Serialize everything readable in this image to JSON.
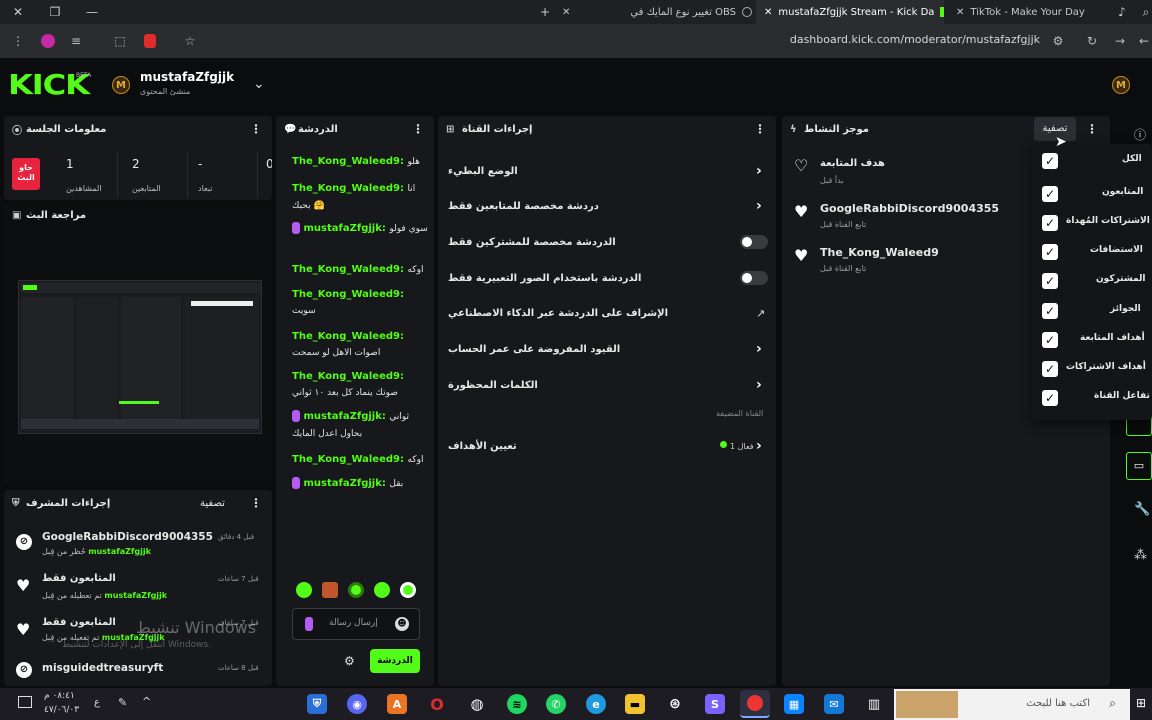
{
  "browser": {
    "tabs": [
      {
        "title": "تغيير نوع المايك في OBS"
      },
      {
        "title": "mustafaZfgjjk Stream - Kick Da"
      },
      {
        "title": "TikTok - Make Your Day"
      }
    ],
    "url": "dashboard.kick.com/moderator/mustafazfgjjk"
  },
  "header": {
    "logo": "KICK",
    "beta": "BETA",
    "user_initial": "M",
    "username": "mustafaZfgjjk",
    "role": "منشئ المحتوى"
  },
  "session": {
    "title": "معلومات الجلسة",
    "live_badge": "حاو البث",
    "stats": [
      {
        "value": "1",
        "label": "المشاهدين"
      },
      {
        "value": "2",
        "label": "المتابعين"
      },
      {
        "value": "-",
        "label": "تبعاد"
      },
      {
        "value": "0",
        "label": ""
      }
    ]
  },
  "stream_review": {
    "title": "مراجعة البث"
  },
  "mod_actions": {
    "title": "إجراءات المشرف",
    "filter": "تصفية",
    "items": [
      {
        "user": "GoogleRabbiDiscord9004355",
        "desc": "حُظر من قِبل",
        "by": "mustafaZfgjjk",
        "time": "قبل 4 دقائق",
        "icon": "ban-icon"
      },
      {
        "user": "المتابعون فقط",
        "desc": "تم تعطيله من قِبل",
        "by": "mustafaZfgjjk",
        "time": "قبل 7 ساعات",
        "icon": "heart-icon"
      },
      {
        "user": "المتابعون فقط",
        "desc": "تم تفعيله من قِبل",
        "by": "mustafaZfgjjk",
        "time": "قبل 7 ساعات",
        "icon": "heart-icon"
      },
      {
        "user": "misguidedtreasuryft",
        "desc": "",
        "by": "",
        "time": "قبل 8 ساعات",
        "icon": "ban-icon"
      }
    ]
  },
  "watermark": {
    "line1": "تنشيط Windows",
    "line2": "انتقل إلى الإعدادات لتنشيط Windows."
  },
  "chat": {
    "title": "الدردشة",
    "messages": [
      {
        "user": "The_Kong_Waleed9:",
        "text": "هلو",
        "inline": true
      },
      {
        "user": "The_Kong_Waleed9:",
        "text": "انا بحبك 🤗",
        "inline": false
      },
      {
        "user": "mustafaZfgjjk:",
        "text": "سوي فولو",
        "inline": false,
        "mod": true
      },
      {
        "user": "The_Kong_Waleed9:",
        "text": "اوكه",
        "inline": true
      },
      {
        "user": "The_Kong_Waleed9:",
        "text": "سويت",
        "inline": false
      },
      {
        "user": "The_Kong_Waleed9:",
        "text": "اصوات الاهل لو سمحت",
        "inline": false
      },
      {
        "user": "The_Kong_Waleed9:",
        "text": "صوتك ينماد كل بعد ١٠ ثواني",
        "inline": false
      },
      {
        "user": "mustafaZfgjjk:",
        "text": "ثواني بحاول اعدل المايك",
        "inline": false,
        "mod": true
      },
      {
        "user": "The_Kong_Waleed9:",
        "text": "اوكه",
        "inline": true
      },
      {
        "user": "mustafaZfgjjk:",
        "text": "بقل",
        "inline": true,
        "mod": true
      }
    ],
    "input_placeholder": "إرسال رسالة",
    "send_label": "الدردشة"
  },
  "channel_actions": {
    "title": "إجراءات القناة",
    "items": [
      {
        "label": "الوضع البطيء",
        "control": "chevron"
      },
      {
        "label": "دردشة مخصصة للمتابعين فقط",
        "control": "chevron"
      },
      {
        "label": "الدردشة مخصصة للمشتركين فقط",
        "control": "toggle"
      },
      {
        "label": "الدردشة باستخدام الصور التعبيرية فقط",
        "control": "toggle"
      },
      {
        "label": "الإشراف على الدردشة عبر الذكاء الاصطناعي",
        "control": "external"
      },
      {
        "label": "القيود المفروضة على عمر الحساب",
        "control": "chevron"
      },
      {
        "label": "الكلمات المحظورة",
        "control": "chevron"
      }
    ],
    "hosted_label": "القناة المضيفة",
    "goals_label": "تعيين الأهداف",
    "goals_status": "فعال 1"
  },
  "activity": {
    "title": "موجز النشاط",
    "filter": "تصفية",
    "items": [
      {
        "user": "هدف المتابعة",
        "desc": "بدأ قبل"
      },
      {
        "user": "GoogleRabbiDiscord9004355",
        "desc": "تابع القناة قبل"
      },
      {
        "user": "The_Kong_Waleed9",
        "desc": "تابع القناة قبل"
      }
    ]
  },
  "filter_menu": {
    "options": [
      "الكل",
      "المتابعون",
      "الاشتراكات المُهداة",
      "الاستضافات",
      "المشتركون",
      "الجوائز",
      "أهداف المتابعة",
      "أهداف الاشتراكات",
      "تفاعل القناة"
    ]
  },
  "taskbar": {
    "search_placeholder": "اكتب هنا للبحث",
    "time": "٠٨:٤١ م",
    "date": "٤٧/٠٦/٠٣"
  }
}
